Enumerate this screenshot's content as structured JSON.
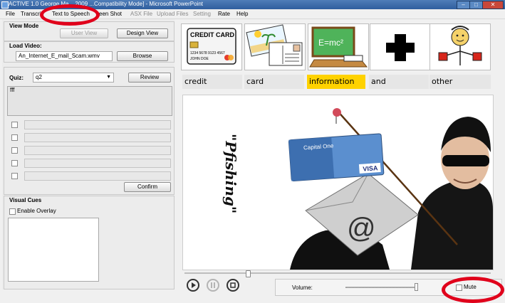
{
  "window": {
    "title": "ACTIVE 1.0 George Ma... 2009   ...Compatibility Mode] - Microsoft PowerPoint"
  },
  "menu": [
    {
      "label": "File",
      "enabled": true
    },
    {
      "label": "Transcri",
      "enabled": true
    },
    {
      "label": "Text to Speech",
      "enabled": true
    },
    {
      "label": "een Shot",
      "enabled": true
    },
    {
      "label": "ASX File",
      "enabled": false
    },
    {
      "label": "Upload Files",
      "enabled": false
    },
    {
      "label": "Setting",
      "enabled": false
    },
    {
      "label": "Rate",
      "enabled": true
    },
    {
      "label": "Help",
      "enabled": true
    }
  ],
  "view_mode": {
    "heading": "View Mode",
    "user_view": "User View",
    "design_view": "Design View"
  },
  "load_video": {
    "heading": "Load Video:",
    "filename": "An_Internet_E_mail_Scam.wmv",
    "browse": "Browse"
  },
  "quiz": {
    "label": "Quiz:",
    "selected": "q2",
    "review": "Review",
    "question_text": "fff",
    "option_count": 5,
    "confirm": "Confirm"
  },
  "visual_cues": {
    "heading": "Visual Cues",
    "overlay_label": "Enable Overlay"
  },
  "symbol_cards": [
    {
      "name": "credit-card-picture",
      "title": "CREDIT CARD",
      "number": "1234 5678 9123 4567",
      "holder": "JOHN DOE"
    },
    {
      "name": "postcard-picture"
    },
    {
      "name": "information-picture",
      "formula": "E=mc²"
    },
    {
      "name": "plus-picture"
    },
    {
      "name": "person-picture"
    }
  ],
  "words": [
    {
      "text": "credit",
      "highlight": false
    },
    {
      "text": "card",
      "highlight": false
    },
    {
      "text": "information",
      "highlight": true
    },
    {
      "text": "and",
      "highlight": false
    },
    {
      "text": "other",
      "highlight": false
    }
  ],
  "video_frame": {
    "phishing_text": "\"Pfishing\"",
    "card_brand": "Capital One",
    "card_network": "VISA",
    "at_symbol": "@"
  },
  "player": {
    "volume_label": "Volume:",
    "mute_label": "Mute",
    "volume_level": 0.95,
    "seek_position": 0.2
  },
  "colors": {
    "highlight": "#ffd200",
    "annotation_red": "#e0001b",
    "title_blue": "#3a6aa8"
  }
}
